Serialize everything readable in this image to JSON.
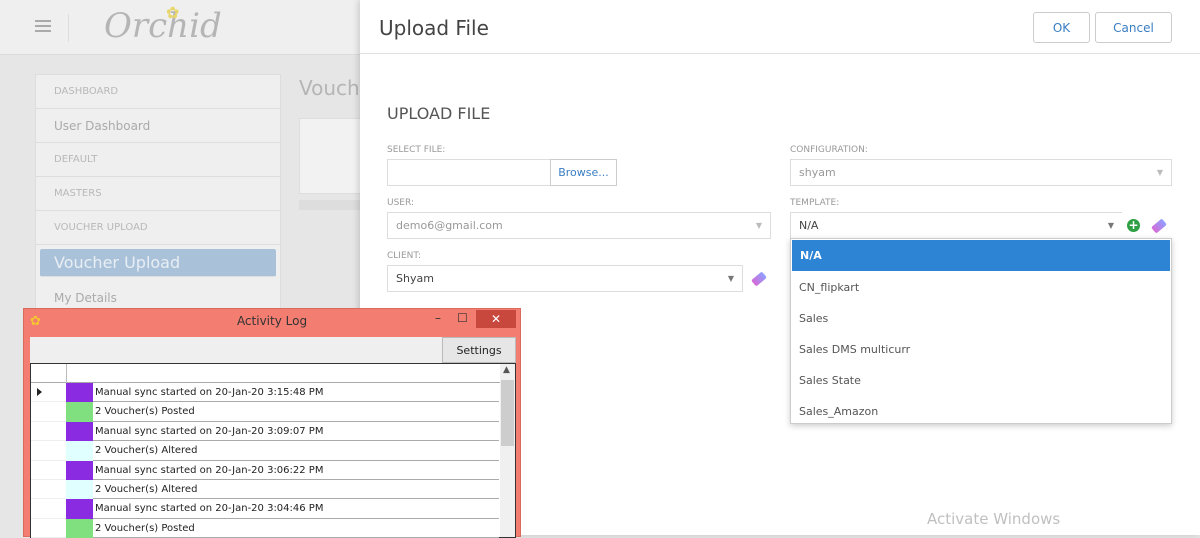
{
  "app": {
    "logo_text": "Orchid"
  },
  "sidebar": {
    "items": [
      {
        "label": "DASHBOARD",
        "type": "header"
      },
      {
        "label": "User Dashboard",
        "type": "item"
      },
      {
        "label": "DEFAULT",
        "type": "header"
      },
      {
        "label": "MASTERS",
        "type": "header"
      },
      {
        "label": "VOUCHER UPLOAD",
        "type": "header"
      },
      {
        "label": "Voucher Upload",
        "type": "active"
      },
      {
        "label": "My Details",
        "type": "item"
      }
    ]
  },
  "background": {
    "page_title": "Vouch"
  },
  "modal": {
    "title": "Upload File",
    "ok": "OK",
    "cancel": "Cancel",
    "section": "UPLOAD FILE",
    "select_file": {
      "label": "SELECT FILE:",
      "value": "",
      "browse": "Browse..."
    },
    "user": {
      "label": "USER:",
      "value": "demo6@gmail.com"
    },
    "client": {
      "label": "CLIENT:",
      "value": "Shyam"
    },
    "configuration": {
      "label": "CONFIGURATION:",
      "value": "shyam"
    },
    "template": {
      "label": "TEMPLATE:",
      "value": "N/A",
      "options": [
        "N/A",
        "CN_flipkart",
        "Sales",
        "Sales DMS multicurr",
        "Sales State",
        "Sales_Amazon"
      ]
    }
  },
  "watermark": {
    "line1": "Activate Windows"
  },
  "activity_log": {
    "title": "Activity Log",
    "settings": "Settings",
    "rows": [
      {
        "text": "Manual sync started on 20-Jan-20 3:15:48 PM",
        "color": "#8a2be2",
        "current": true
      },
      {
        "text": "2 Voucher(s) Posted",
        "color": "#80e080"
      },
      {
        "text": "Manual sync started on 20-Jan-20 3:09:07 PM",
        "color": "#8a2be2"
      },
      {
        "text": "2 Voucher(s) Altered",
        "color": "#e0ffff"
      },
      {
        "text": "Manual sync started on 20-Jan-20 3:06:22 PM",
        "color": "#8a2be2"
      },
      {
        "text": "2 Voucher(s) Altered",
        "color": "#e0ffff"
      },
      {
        "text": "Manual sync started on 20-Jan-20 3:04:46 PM",
        "color": "#8a2be2"
      },
      {
        "text": "2 Voucher(s) Posted",
        "color": "#80e080"
      }
    ]
  }
}
